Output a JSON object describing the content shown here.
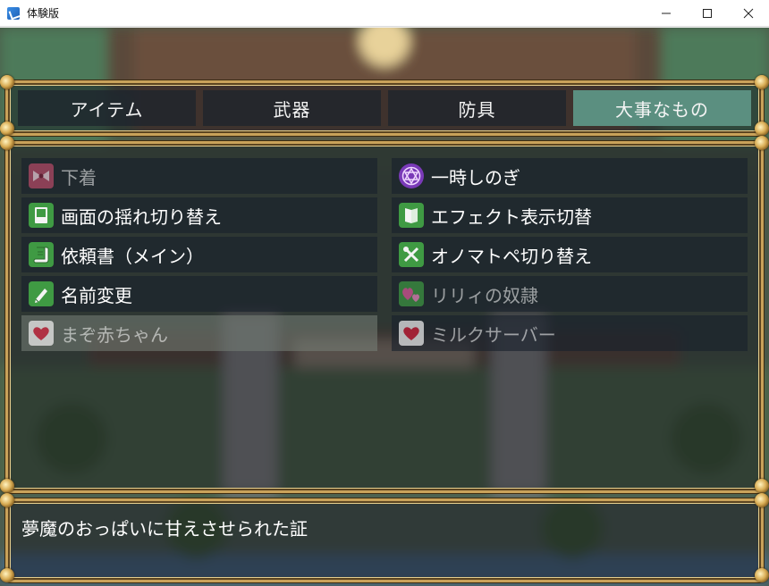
{
  "window": {
    "title": "体験版",
    "minimize_icon": "minimize-icon",
    "maximize_icon": "maximize-icon",
    "close_icon": "close-icon"
  },
  "tabs": [
    {
      "label": "アイテム",
      "active": false
    },
    {
      "label": "武器",
      "active": false
    },
    {
      "label": "防具",
      "active": false
    },
    {
      "label": "大事なもの",
      "active": true
    }
  ],
  "items": [
    {
      "label": "下着",
      "icon": "ribbon-icon",
      "enabled": false
    },
    {
      "label": "一時しのぎ",
      "icon": "hexagram-icon",
      "enabled": true
    },
    {
      "label": "画面の揺れ切り替え",
      "icon": "book-icon",
      "enabled": true
    },
    {
      "label": "エフェクト表示切替",
      "icon": "book-open-icon",
      "enabled": true
    },
    {
      "label": "依頼書（メイン）",
      "icon": "scroll-icon",
      "enabled": true
    },
    {
      "label": "オノマトペ切り替え",
      "icon": "tools-icon",
      "enabled": true
    },
    {
      "label": "名前変更",
      "icon": "pen-icon",
      "enabled": true
    },
    {
      "label": "リリィの奴隷",
      "icon": "hearts-icon",
      "enabled": false
    },
    {
      "label": "まぞ赤ちゃん",
      "icon": "heart-icon",
      "enabled": false,
      "selected": true
    },
    {
      "label": "ミルクサーバー",
      "icon": "heart-icon",
      "enabled": false
    }
  ],
  "description": "夢魔のおっぱいに甘えさせられた証",
  "colors": {
    "frame_gold": "#c9a25a",
    "active_tab": "#5b8f80",
    "heart_red": "#d6203a"
  }
}
